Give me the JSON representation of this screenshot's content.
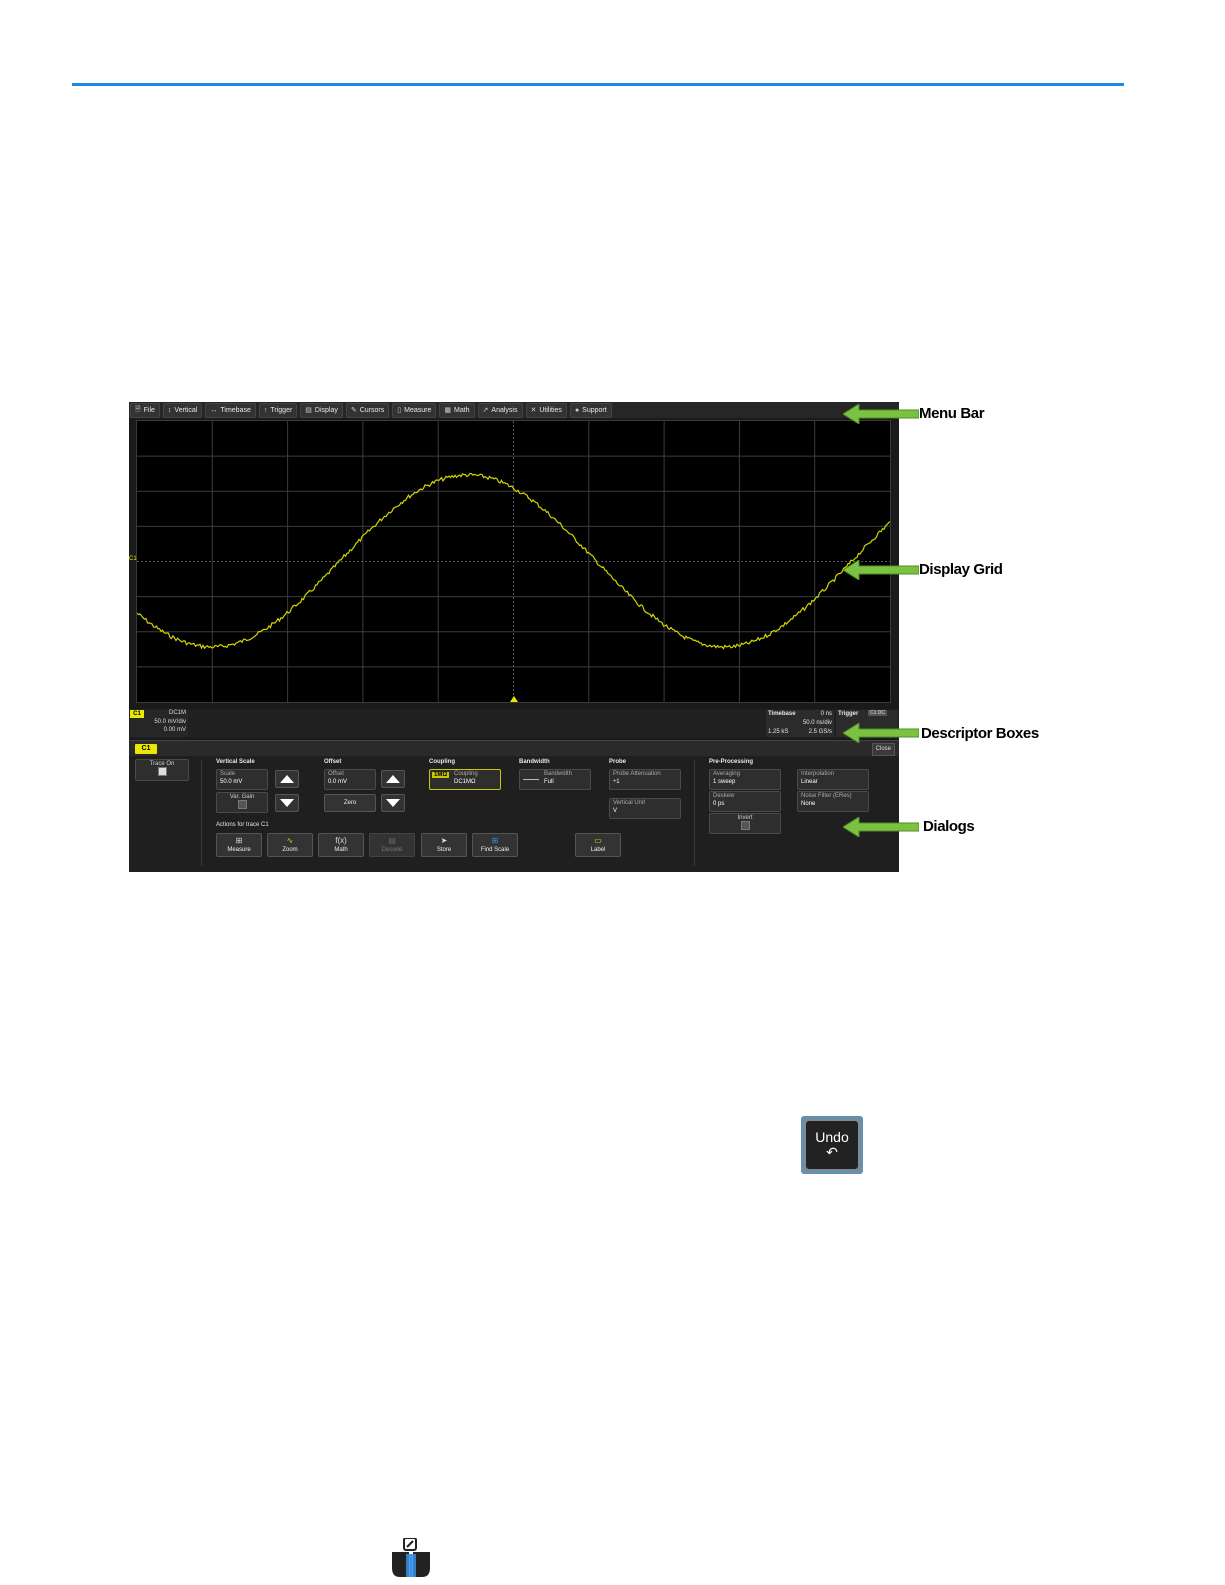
{
  "menu": {
    "items": [
      {
        "label": "File",
        "icon": "file-icon",
        "glyph": "🗎"
      },
      {
        "label": "Vertical",
        "icon": "vertical-icon",
        "glyph": "↕"
      },
      {
        "label": "Timebase",
        "icon": "timebase-icon",
        "glyph": "↔"
      },
      {
        "label": "Trigger",
        "icon": "trigger-icon",
        "glyph": "↑"
      },
      {
        "label": "Display",
        "icon": "display-icon",
        "glyph": "▤"
      },
      {
        "label": "Cursors",
        "icon": "cursors-icon",
        "glyph": "✎"
      },
      {
        "label": "Measure",
        "icon": "measure-icon",
        "glyph": "▯"
      },
      {
        "label": "Math",
        "icon": "math-icon",
        "glyph": "▦"
      },
      {
        "label": "Analysis",
        "icon": "analysis-icon",
        "glyph": "↗"
      },
      {
        "label": "Utilities",
        "icon": "utilities-icon",
        "glyph": "✕"
      },
      {
        "label": "Support",
        "icon": "support-icon",
        "glyph": "●"
      }
    ]
  },
  "colors": {
    "trace": "#d4d400",
    "accent": "#1e88e5",
    "arrow": "#7cc242"
  },
  "grid": {
    "ch_marker": "C1"
  },
  "descriptors": {
    "c1": {
      "tag": "C1",
      "coupling": "DC1M",
      "vdiv": "50.0 mV/div",
      "offset": "0.00 mV"
    },
    "timebase": {
      "title": "Timebase",
      "delay": "0 ns",
      "tdiv": "50.0 ns/div",
      "samples": "1.25 kS",
      "rate": "2.5 GS/s"
    },
    "trigger": {
      "title": "Trigger",
      "badge": "C1 DC"
    }
  },
  "tab": {
    "label": "C1",
    "close": "Close"
  },
  "dialog": {
    "trace_on": "Trace On",
    "vertical_scale": {
      "title": "Vertical Scale",
      "scale_label": "Scale",
      "scale_value": "50.0 mV",
      "var_gain": "Var. Gain"
    },
    "offset": {
      "title": "Offset",
      "offset_label": "Offset",
      "offset_value": "0.0 mV",
      "zero": "Zero"
    },
    "coupling": {
      "title": "Coupling",
      "badge": "1MΩ",
      "label": "Coupling",
      "value": "DC1MΩ"
    },
    "bandwidth": {
      "title": "Bandwidth",
      "label": "Bandwidth",
      "value": "Full"
    },
    "probe": {
      "title": "Probe",
      "atten_label": "Probe Attenuation",
      "atten_value": "÷1",
      "unit_label": "Vertical Unit",
      "unit_value": "V"
    },
    "preproc": {
      "title": "Pre-Processing",
      "avg_label": "Averaging",
      "avg_value": "1 sweep",
      "deskew_label": "Deskew",
      "deskew_value": "0 ps",
      "invert": "Invert",
      "interp_label": "Interpolation",
      "interp_value": "Linear",
      "noise_label": "Noise Filter (ERes)",
      "noise_value": "None"
    },
    "actions_title": "Actions for trace C1",
    "actions": [
      {
        "label": "Measure",
        "icon": "measure-icon",
        "glyph": "⊞"
      },
      {
        "label": "Zoom",
        "icon": "zoom-icon",
        "glyph": "∿"
      },
      {
        "label": "Math",
        "icon": "math-icon",
        "glyph": "f(x)"
      },
      {
        "label": "Decode",
        "icon": "decode-icon",
        "glyph": "▤"
      },
      {
        "label": "Store",
        "icon": "store-icon",
        "glyph": "➤"
      },
      {
        "label": "Find Scale",
        "icon": "find-scale-icon",
        "glyph": "⊞"
      },
      {
        "label": "Label",
        "icon": "label-icon",
        "glyph": "▭"
      }
    ]
  },
  "annotations": {
    "menu_bar": "Menu Bar",
    "display_grid": "Display Grid",
    "descriptor_boxes": "Descriptor Boxes",
    "dialogs": "Dialogs"
  },
  "undo": {
    "label": "Undo",
    "icon": "undo-icon",
    "glyph": "↶"
  }
}
